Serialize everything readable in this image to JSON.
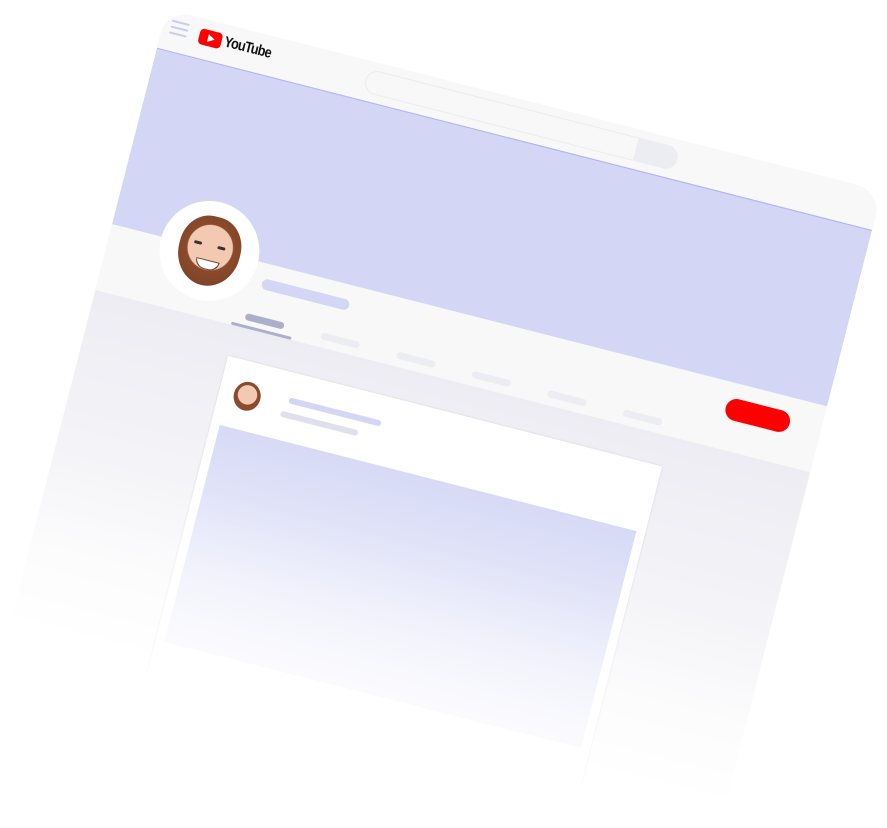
{
  "header": {
    "menu_icon": "hamburger-icon",
    "logo_text": "YouTube",
    "brand_color": "#ff0000"
  },
  "banner": {
    "color": "#d3d6f5"
  },
  "channel": {
    "avatar": "memoji-avatar",
    "tab_count": 6,
    "active_tab_index": 0,
    "subscribe_color": "#ff0000"
  },
  "post": {
    "avatar": "memoji-avatar"
  }
}
